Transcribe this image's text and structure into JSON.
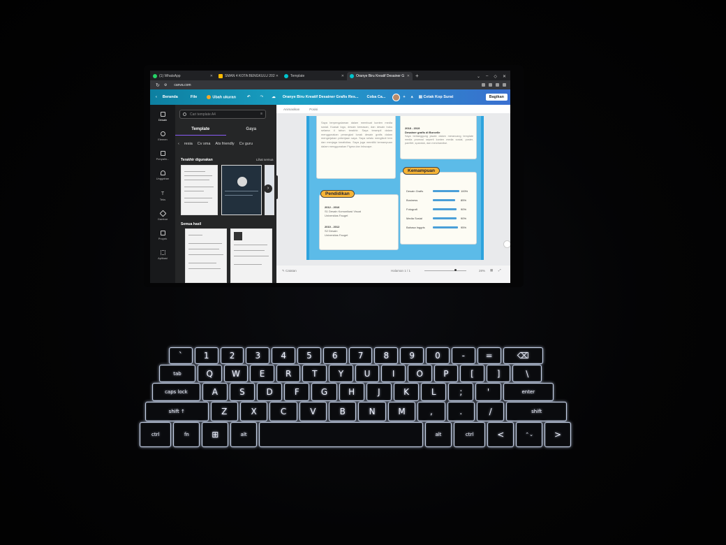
{
  "browser": {
    "tabs": [
      {
        "label": "(1) WhatsApp",
        "color": "#25d366",
        "active": false
      },
      {
        "label": "SMAN 4 KOTA BENGKULU 202",
        "color": "#ffbb00",
        "active": false
      },
      {
        "label": "Template",
        "color": "#00c4cc",
        "active": false
      },
      {
        "label": "Oranye Biru Kreatif Desainer G",
        "color": "#00c4cc",
        "active": true
      }
    ],
    "new_tab": "+",
    "url": "canva.com"
  },
  "canva_toolbar": {
    "home": "Beranda",
    "file": "File",
    "resize": "Ubah ukuran",
    "doc_title": "Oranye Biru Kreatif Desainer Grafis Res...",
    "try_label": "Coba Ca...",
    "print_label": "Cetak Kop Surat",
    "share_label": "Bagikan"
  },
  "rail": {
    "items": [
      "Desain",
      "Elemen",
      "Penyalin...",
      "Unggahan",
      "Teks",
      "Gambar",
      "Proyek",
      "Aplikasi"
    ]
  },
  "panel": {
    "search_placeholder": "Cari template A4",
    "tabs": [
      "Template",
      "Gaya"
    ],
    "chips": [
      "resia",
      "Cv sma",
      "Ats friendly",
      "Cv guru"
    ],
    "recent_heading": "Terakhir digunakan",
    "see_all": "Lihat semua",
    "all_results": "Semua hasil"
  },
  "editor": {
    "toolbar": [
      "Animasikan",
      "Posisi"
    ],
    "notes": "Catatan",
    "page_count": "Halaman 1 / 1",
    "zoom": "28%"
  },
  "resume": {
    "experience_text_top": "Saya berpengalaman dalam membuat konten media sosial. Kuasai logo, desain kemasan, dan desain buku selama 4 tahun terakhir. Saya terampil dalam menggunakan perangkat lunak desain grafis dalam mengerjakan pekerjaan saya. Saya selalu mengikuti tren dan menjaga kreativitas. Saya juga memiliki kemampuan dalam menggunakan Figma dan Inkscape.",
    "job_period": "2018 - 2019",
    "job_title": "Desainer grafis di Borcelle",
    "job_desc": "Saya bertanggung jawab dalam merancang template media promosi seperti konten media sosial, poster, pamflet, spanduk, dan merchandise.",
    "education_title": "Pendidikan",
    "education": [
      {
        "period": "2012 - 2016",
        "degree": "S1 Desain Komunikasi Visual",
        "school": "Universitas Fauget"
      },
      {
        "period": "2010 - 2012",
        "degree": "S2 Desain",
        "school": "Universitas Fauget"
      }
    ],
    "skills_title": "Kemampuan",
    "skills": [
      {
        "name": "Desain Grafis",
        "percent": 100,
        "label": "100%"
      },
      {
        "name": "Business",
        "percent": 85,
        "label": "85%"
      },
      {
        "name": "Fotografi",
        "percent": 90,
        "label": "90%"
      },
      {
        "name": "Media Sosial",
        "percent": 90,
        "label": "90%"
      },
      {
        "name": "Bahasa Inggris",
        "percent": 95,
        "label": "95%"
      }
    ]
  },
  "keyboard": {
    "row_numbers": [
      "`",
      "1",
      "2",
      "3",
      "4",
      "5",
      "6",
      "7",
      "8",
      "9",
      "0",
      "-",
      "=",
      "⌫"
    ],
    "row_q": [
      "tab",
      "Q",
      "W",
      "E",
      "R",
      "T",
      "Y",
      "U",
      "I",
      "O",
      "P",
      "[",
      "]",
      "\\"
    ],
    "row_a": [
      "caps lock",
      "A",
      "S",
      "D",
      "F",
      "G",
      "H",
      "J",
      "K",
      "L",
      ";",
      "'",
      "enter"
    ],
    "row_z": [
      "shift ↑",
      "Z",
      "X",
      "C",
      "V",
      "B",
      "N",
      "M",
      ",",
      ".",
      "/",
      "shift"
    ],
    "row_bottom": [
      "ctrl",
      "fn",
      "⊞",
      "alt",
      "",
      "alt",
      "ctrl",
      "<",
      "⌃⌄",
      ">"
    ]
  }
}
